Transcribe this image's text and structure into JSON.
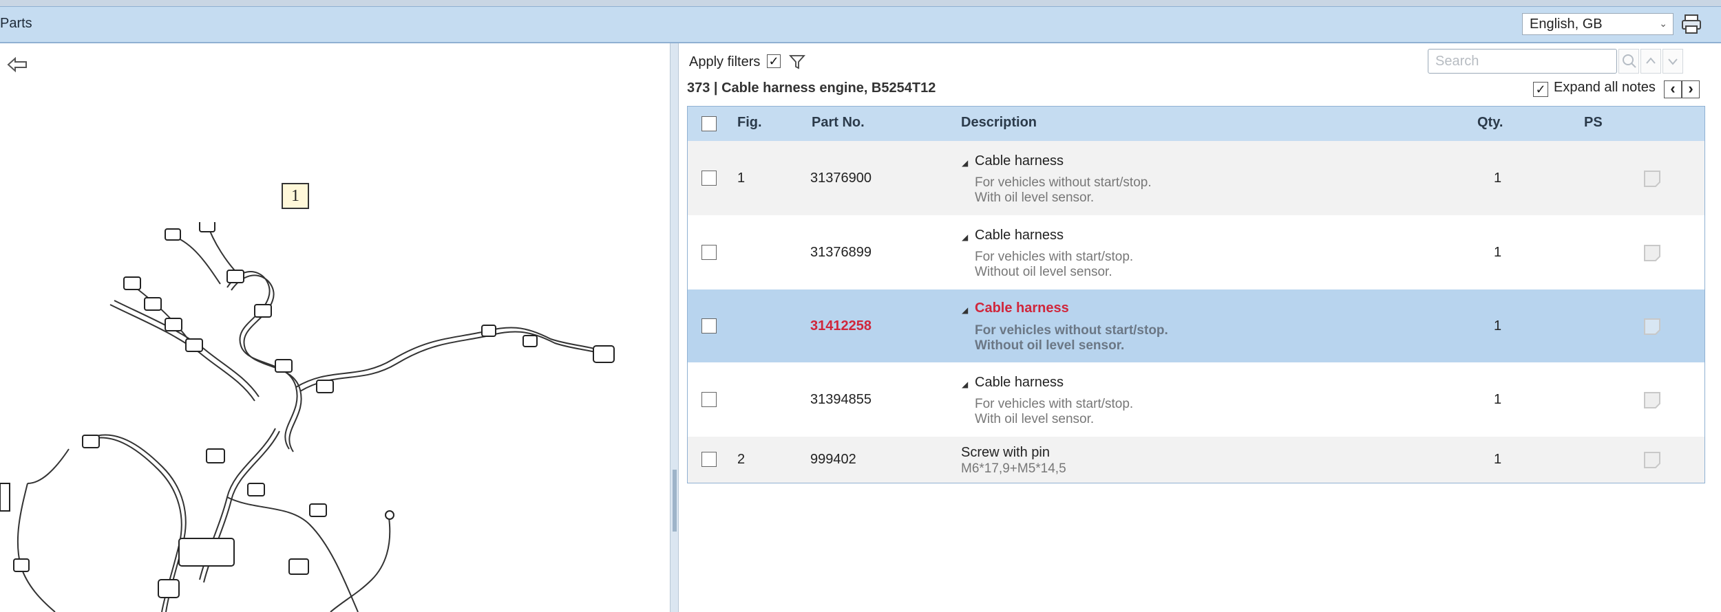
{
  "header": {
    "title": "Parts",
    "language": "English, GB"
  },
  "left": {
    "callout_label": "1"
  },
  "toolbar": {
    "apply_filters_label": "Apply filters",
    "apply_filters_checked": true,
    "section_title": "373  |  Cable harness engine, B5254T12",
    "search_placeholder": "Search",
    "expand_all_label": "Expand all notes",
    "expand_all_checked": true
  },
  "table": {
    "columns": {
      "fig": "Fig.",
      "partno": "Part No.",
      "description": "Description",
      "qty": "Qty.",
      "ps": "PS"
    },
    "rows": [
      {
        "fig": "1",
        "partno": "31376900",
        "title": "Cable harness",
        "note1": "For vehicles without start/stop.",
        "note2": "With oil level sensor.",
        "qty": "1",
        "selected": false
      },
      {
        "fig": "",
        "partno": "31376899",
        "title": "Cable harness",
        "note1": "For vehicles with start/stop.",
        "note2": "Without oil level sensor.",
        "qty": "1",
        "selected": false
      },
      {
        "fig": "",
        "partno": "31412258",
        "title": "Cable harness",
        "note1": "For vehicles without start/stop.",
        "note2": "Without oil level sensor.",
        "qty": "1",
        "selected": true
      },
      {
        "fig": "",
        "partno": "31394855",
        "title": "Cable harness",
        "note1": "For vehicles with start/stop.",
        "note2": "With oil level sensor.",
        "qty": "1",
        "selected": false
      },
      {
        "fig": "2",
        "partno": "999402",
        "title": "Screw with pin",
        "note1": "M6*17,9+M5*14,5",
        "qty": "1",
        "selected": false
      }
    ]
  },
  "colors": {
    "header_bg": "#c5dcf1",
    "selected_row_bg": "#b8d4ee",
    "selected_text": "#d0263b"
  }
}
